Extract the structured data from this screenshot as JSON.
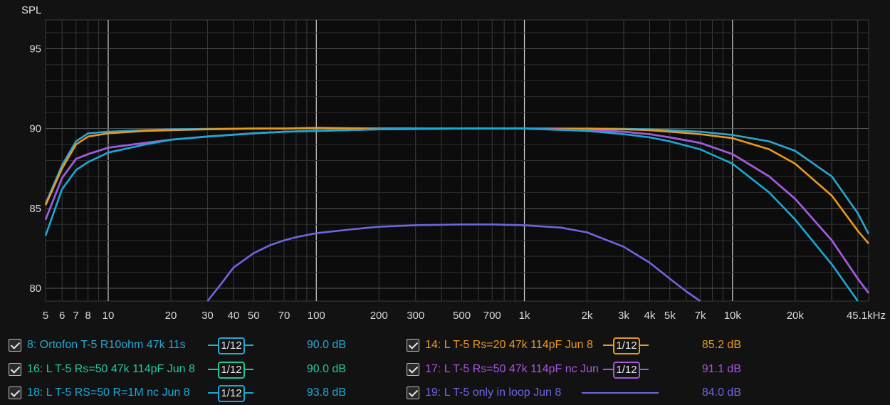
{
  "chart_data": {
    "type": "line",
    "ylabel": "SPL",
    "x_scale": "log",
    "xlim": [
      5,
      45100
    ],
    "ylim": [
      79.2,
      96.8
    ],
    "y_ticks": [
      80,
      85,
      90,
      95
    ],
    "x_tick_values": [
      5,
      6,
      7,
      8,
      10,
      20,
      30,
      40,
      50,
      70,
      100,
      200,
      300,
      500,
      700,
      1000,
      2000,
      3000,
      4000,
      5000,
      7000,
      10000,
      20000,
      45100
    ],
    "x_tick_labels": [
      "5",
      "6",
      "7",
      "8",
      "10",
      "20",
      "30",
      "40",
      "50",
      "70",
      "100",
      "200",
      "300",
      "500",
      "700",
      "1k",
      "2k",
      "3k",
      "4k",
      "5k",
      "7k",
      "10k",
      "20k",
      "45.1kHz"
    ],
    "grid": true,
    "series": [
      {
        "name": "8: Ortofon T-5 R10ohm 47k 11s",
        "color": "#2aa7d0",
        "smoothing": "1/12",
        "level": "90.0 dB",
        "x": [
          5,
          6,
          7,
          8,
          10,
          15,
          20,
          30,
          50,
          70,
          100,
          200,
          500,
          1000,
          2000,
          3000,
          4000,
          5000,
          7000,
          10000,
          15000,
          20000,
          30000,
          40000,
          45100
        ],
        "y": [
          85.3,
          87.7,
          89.2,
          89.7,
          89.8,
          89.9,
          89.95,
          89.98,
          90.0,
          90.0,
          90.0,
          90.0,
          90.0,
          90.0,
          90.0,
          89.98,
          89.95,
          89.9,
          89.8,
          89.6,
          89.2,
          88.6,
          87.0,
          84.7,
          83.4
        ]
      },
      {
        "name": "14: L T-5 Rs=20 47k 114pF Jun 8",
        "color": "#e89a1c",
        "smoothing": "1/12",
        "level": "85.2 dB",
        "x": [
          5,
          6,
          7,
          8,
          10,
          15,
          20,
          30,
          50,
          70,
          100,
          200,
          500,
          1000,
          2000,
          3000,
          4000,
          5000,
          7000,
          10000,
          15000,
          20000,
          30000,
          40000,
          45100
        ],
        "y": [
          85.2,
          87.5,
          89.0,
          89.5,
          89.7,
          89.85,
          89.9,
          89.95,
          90.0,
          90.0,
          90.05,
          90.0,
          90.0,
          90.0,
          89.98,
          89.95,
          89.9,
          89.8,
          89.65,
          89.4,
          88.7,
          87.8,
          85.8,
          83.6,
          82.8
        ]
      },
      {
        "name": "16: L T-5 Rs=50 47k 114pF Jun 8",
        "color": "#1fc9a0",
        "smoothing": "1/12",
        "level": "90.0 dB",
        "x": [
          5,
          6,
          7,
          8,
          10,
          15,
          20,
          30,
          50,
          70,
          100,
          200,
          500,
          1000,
          2000,
          3000,
          4000,
          5000,
          7000,
          10000,
          15000,
          20000,
          30000,
          40000,
          45100
        ],
        "y": [
          84.3,
          86.9,
          88.1,
          88.4,
          88.8,
          89.1,
          89.3,
          89.5,
          89.7,
          89.8,
          89.85,
          89.95,
          90.0,
          90.0,
          89.9,
          89.8,
          89.65,
          89.45,
          89.1,
          88.4,
          87.0,
          85.6,
          83.0,
          80.6,
          79.7
        ]
      },
      {
        "name": "17: L T-5 Rs=50 47k 114pF nc Jun 8",
        "color": "#a855e0",
        "smoothing": "1/12",
        "level": "91.1 dB",
        "x": [
          5,
          6,
          7,
          8,
          10,
          15,
          20,
          30,
          50,
          70,
          100,
          200,
          500,
          1000,
          2000,
          3000,
          4000,
          5000,
          7000,
          10000,
          15000,
          20000,
          30000,
          40000,
          45100
        ],
        "y": [
          84.3,
          86.9,
          88.1,
          88.4,
          88.8,
          89.1,
          89.3,
          89.5,
          89.7,
          89.8,
          89.85,
          89.95,
          90.0,
          90.0,
          89.9,
          89.8,
          89.65,
          89.45,
          89.1,
          88.4,
          87.0,
          85.6,
          83.0,
          80.6,
          79.7
        ]
      },
      {
        "name": "18: L T-5 RS=50 R=1M nc Jun 8",
        "color": "#1aa9d6",
        "smoothing": "1/12",
        "level": "93.8 dB",
        "x": [
          5,
          6,
          7,
          8,
          10,
          15,
          20,
          30,
          50,
          70,
          100,
          200,
          500,
          1000,
          2000,
          3000,
          4000,
          5000,
          7000,
          10000,
          15000,
          20000,
          30000,
          40000
        ],
        "y": [
          83.3,
          86.2,
          87.4,
          87.9,
          88.5,
          89.0,
          89.3,
          89.5,
          89.7,
          89.8,
          89.85,
          89.95,
          90.0,
          90.0,
          89.85,
          89.65,
          89.45,
          89.2,
          88.7,
          87.8,
          86.0,
          84.3,
          81.5,
          79.2
        ]
      },
      {
        "name": "19: L T-5 only in loop Jun 8",
        "color": "#6e66e0",
        "smoothing": "",
        "level": "84.0 dB",
        "x": [
          30,
          35,
          40,
          50,
          60,
          70,
          80,
          100,
          150,
          200,
          300,
          500,
          700,
          1000,
          1500,
          2000,
          3000,
          4000,
          5000,
          6000,
          7000
        ],
        "y": [
          79.2,
          80.3,
          81.3,
          82.2,
          82.7,
          83.0,
          83.2,
          83.45,
          83.7,
          83.85,
          83.95,
          84.0,
          84.0,
          83.95,
          83.8,
          83.5,
          82.6,
          81.6,
          80.6,
          79.8,
          79.2
        ]
      }
    ]
  }
}
